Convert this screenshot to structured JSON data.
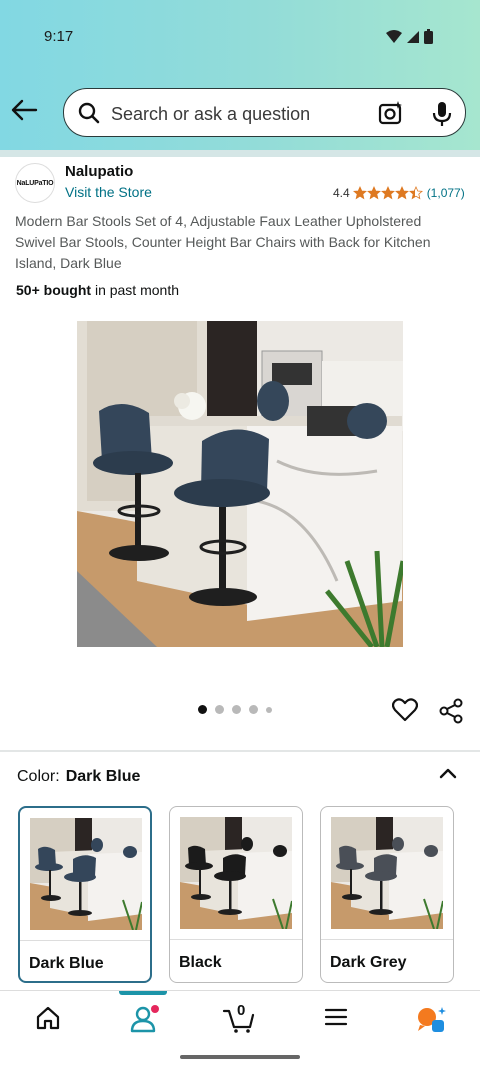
{
  "status": {
    "time": "9:17"
  },
  "search": {
    "placeholder": "Search or ask a question"
  },
  "brand": {
    "logo_text": "NaLUPaTIO",
    "name": "Nalupatio",
    "visit_store": "Visit the Store"
  },
  "rating": {
    "value": "4.4",
    "stars": 4.4,
    "count": "(1,077)",
    "star_color": "#de7921"
  },
  "product": {
    "title": "Modern Bar Stools Set of 4, Adjustable Faux Leather Upholstered Swivel Bar Stools, Counter Height Bar Chairs with Back for Kitchen Island, Dark Blue",
    "bought_bold": "50+ bought",
    "bought_rest": " in past month"
  },
  "carousel": {
    "image_count": 5,
    "active_index": 0
  },
  "color": {
    "label": "Color:",
    "selected": "Dark Blue",
    "options": [
      {
        "name": "Dark Blue",
        "chair_color": "#34465a"
      },
      {
        "name": "Black",
        "chair_color": "#1b1b1b"
      },
      {
        "name": "Dark Grey",
        "chair_color": "#4a4f57"
      }
    ]
  },
  "bottom_nav": {
    "cart_count": "0",
    "active": "account"
  },
  "colors": {
    "accent_teal": "#1c94a8",
    "link": "#007185",
    "header_gradient": [
      "#82d8e3",
      "#a6e6cf"
    ]
  }
}
